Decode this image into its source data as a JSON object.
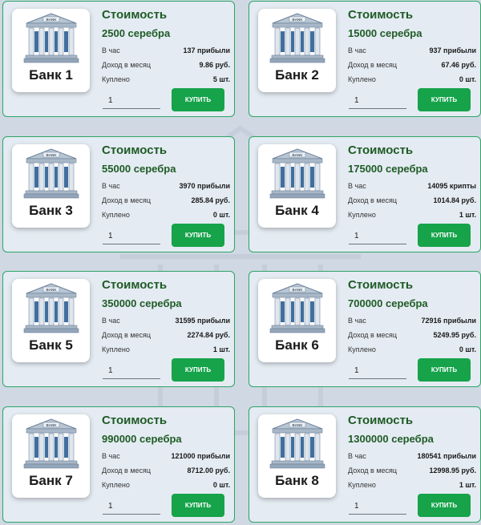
{
  "colors": {
    "accent": "#16a34a",
    "border": "#2ea566",
    "title": "#1f5b26"
  },
  "icon": "bank-building-icon",
  "bank_sign": "BANK",
  "cost_title": "Стоимость",
  "labels": {
    "per_hour": "В час",
    "monthly": "Доход в месяц",
    "bought": "Куплено"
  },
  "buy_label": "КУПИТЬ",
  "cards": [
    {
      "name": "Банк 1",
      "cost": "2500 серебра",
      "per_hour": "137 прибыли",
      "monthly": "9.86 руб.",
      "bought": "5 шт.",
      "qty": "1"
    },
    {
      "name": "Банк 2",
      "cost": "15000 серебра",
      "per_hour": "937 прибыли",
      "monthly": "67.46 руб.",
      "bought": "0 шт.",
      "qty": "1"
    },
    {
      "name": "Банк 3",
      "cost": "55000 серебра",
      "per_hour": "3970 прибыли",
      "monthly": "285.84 руб.",
      "bought": "0 шт.",
      "qty": "1"
    },
    {
      "name": "Банк 4",
      "cost": "175000 серебра",
      "per_hour": "14095 крипты",
      "monthly": "1014.84 руб.",
      "bought": "1 шт.",
      "qty": "1"
    },
    {
      "name": "Банк 5",
      "cost": "350000 серебра",
      "per_hour": "31595 прибыли",
      "monthly": "2274.84 руб.",
      "bought": "1 шт.",
      "qty": "1"
    },
    {
      "name": "Банк 6",
      "cost": "700000 серебра",
      "per_hour": "72916 прибыли",
      "monthly": "5249.95 руб.",
      "bought": "0 шт.",
      "qty": "1"
    },
    {
      "name": "Банк 7",
      "cost": "990000 серебра",
      "per_hour": "121000 прибыли",
      "monthly": "8712.00 руб.",
      "bought": "0 шт.",
      "qty": "1"
    },
    {
      "name": "Банк 8",
      "cost": "1300000 серебра",
      "per_hour": "180541 прибыли",
      "monthly": "12998.95 руб.",
      "bought": "1 шт.",
      "qty": "1"
    }
  ]
}
